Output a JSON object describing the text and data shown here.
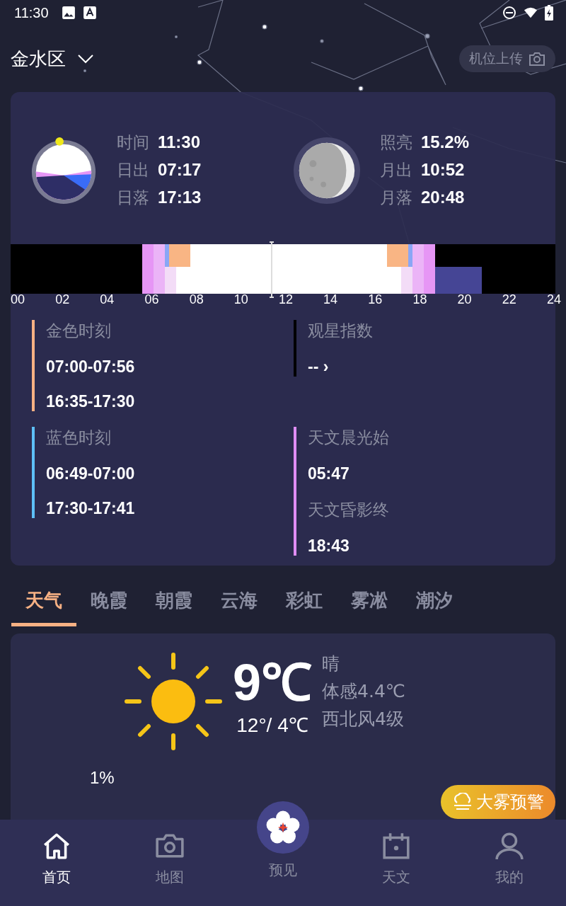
{
  "status_bar": {
    "time": "11:30"
  },
  "header": {
    "location": "金水区",
    "upload_button": "机位上传"
  },
  "sun": {
    "rows": [
      {
        "label": "时间",
        "value": "11:30"
      },
      {
        "label": "日出",
        "value": "07:17"
      },
      {
        "label": "日落",
        "value": "17:13"
      }
    ]
  },
  "moon": {
    "rows": [
      {
        "label": "照亮",
        "value": "15.2%"
      },
      {
        "label": "月出",
        "value": "10:52"
      },
      {
        "label": "月落",
        "value": "20:48"
      }
    ]
  },
  "timeline": {
    "ticks": [
      "00",
      "02",
      "04",
      "06",
      "08",
      "10",
      "12",
      "14",
      "16",
      "18",
      "20",
      "22",
      "24"
    ]
  },
  "periods": [
    {
      "title": "金色时刻",
      "color": "#f7b184",
      "times": [
        "07:00-07:56",
        "16:35-17:30"
      ]
    },
    {
      "title": "观星指数",
      "color": "#000000",
      "times": [
        "-- ›"
      ]
    },
    {
      "title": "蓝色时刻",
      "color": "#5ec0f7",
      "times": [
        "06:49-07:00",
        "17:30-17:41"
      ]
    },
    {
      "title": "天文晨光始",
      "color": "#e08ef5",
      "times": [
        "05:47"
      ],
      "subtitle": "天文昏影终",
      "subtimes": [
        "18:43"
      ]
    }
  ],
  "tabs": [
    {
      "label": "天气",
      "selected": true
    },
    {
      "label": "晚霞",
      "selected": false
    },
    {
      "label": "朝霞",
      "selected": false
    },
    {
      "label": "云海",
      "selected": false
    },
    {
      "label": "彩虹",
      "selected": false
    },
    {
      "label": "雾凇",
      "selected": false
    },
    {
      "label": "潮汐",
      "selected": false
    }
  ],
  "weather": {
    "temperature": "9℃",
    "range": "12°/ 4℃",
    "condition": "晴",
    "feels_like": "体感4.4℃",
    "wind": "西北风4级",
    "humidity": "1%",
    "alert": "大雾预警"
  },
  "nav": [
    {
      "label": "首页",
      "kind": "home",
      "selected": true
    },
    {
      "label": "地图",
      "kind": "camera",
      "selected": false
    },
    {
      "label": "预见",
      "kind": "flower",
      "selected": false
    },
    {
      "label": "天文",
      "kind": "calendar",
      "selected": false
    },
    {
      "label": "我的",
      "kind": "person",
      "selected": false
    }
  ]
}
